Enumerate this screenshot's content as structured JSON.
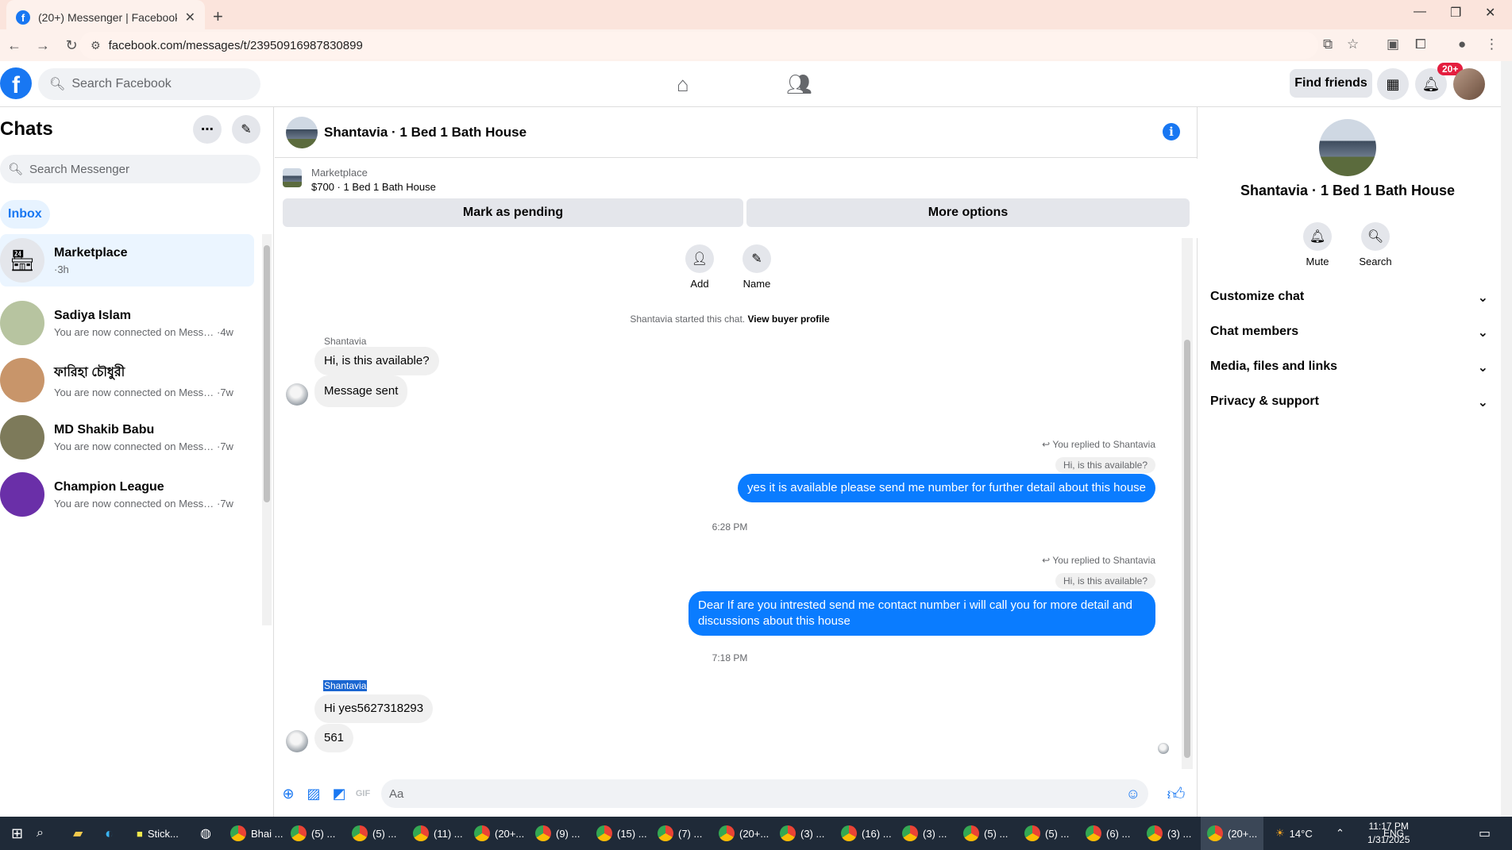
{
  "browser": {
    "tab_title": "(20+) Messenger | Facebook",
    "url": "facebook.com/messages/t/23950916987830899"
  },
  "header": {
    "search_placeholder": "Search Facebook",
    "find_friends": "Find friends",
    "notif_badge": "20+"
  },
  "sidebar": {
    "title": "Chats",
    "search_placeholder": "Search Messenger",
    "inbox_label": "Inbox",
    "chats": [
      {
        "name": "Marketplace",
        "preview": "",
        "time": "·3h",
        "color": "#e4e6eb"
      },
      {
        "name": "Sadiya Islam",
        "preview": "You are now connected on Messe...",
        "time": "·4w",
        "color": "#b7c4a0"
      },
      {
        "name": "ফারিহা চৌধুরী",
        "preview": "You are now connected on Messe...",
        "time": "·7w",
        "color": "#c8956a"
      },
      {
        "name": "MD Shakib Babu",
        "preview": "You are now connected on Messe...",
        "time": "·7w",
        "color": "#7d7a5a"
      },
      {
        "name": "Champion League",
        "preview": "You are now connected on Messe...",
        "time": "·7w",
        "color": "#6a2fa8"
      }
    ]
  },
  "conversation": {
    "title": "Shantavia · 1 Bed 1 Bath House",
    "marketplace_label": "Marketplace",
    "marketplace_item": "$700 · 1 Bed 1 Bath House",
    "mark_pending": "Mark as pending",
    "more_options": "More options",
    "add_label": "Add",
    "name_label": "Name",
    "system_msg": "Shantavia started this chat.",
    "view_buyer": "View buyer profile",
    "sender_name": "Shantavia",
    "msg1": "Hi, is this available?",
    "msg2": "Message sent",
    "replied_label": "You replied to Shantavia",
    "quote1": "Hi, is this available?",
    "reply1": "yes it is available please send me number for further detail about this house",
    "time1": "6:28 PM",
    "quote2": "Hi, is this available?",
    "reply2": "Dear    If are you intrested  send me contact number  i will call you for more detail and discussions about this house",
    "time2": "7:18 PM",
    "sender_name2": "Shantavia",
    "msg3": "Hi yes5627318293",
    "msg4": "561",
    "compose_placeholder": "Aa"
  },
  "info_panel": {
    "title": "Shantavia · 1 Bed 1 Bath House",
    "mute": "Mute",
    "search": "Search",
    "sections": [
      "Customize chat",
      "Chat members",
      "Media, files and links",
      "Privacy & support"
    ]
  },
  "taskbar": {
    "items": [
      "Stick...",
      "Bhai ...",
      "(5) ...",
      "(5) ...",
      "(11) ...",
      "(20+...",
      "(9) ...",
      "(15) ...",
      "(7) ...",
      "(20+...",
      "(3) ...",
      "(16) ...",
      "(3) ...",
      "(5) ...",
      "(5) ...",
      "(6) ...",
      "(3) ...",
      "(20+..."
    ],
    "weather": "14°C",
    "lang": "ENG",
    "time": "11:17 PM",
    "date": "1/31/2025"
  },
  "colors": {
    "brand": "#1877f2",
    "outgoing": "#0a7cff",
    "taskbar": "#1f2a38"
  }
}
